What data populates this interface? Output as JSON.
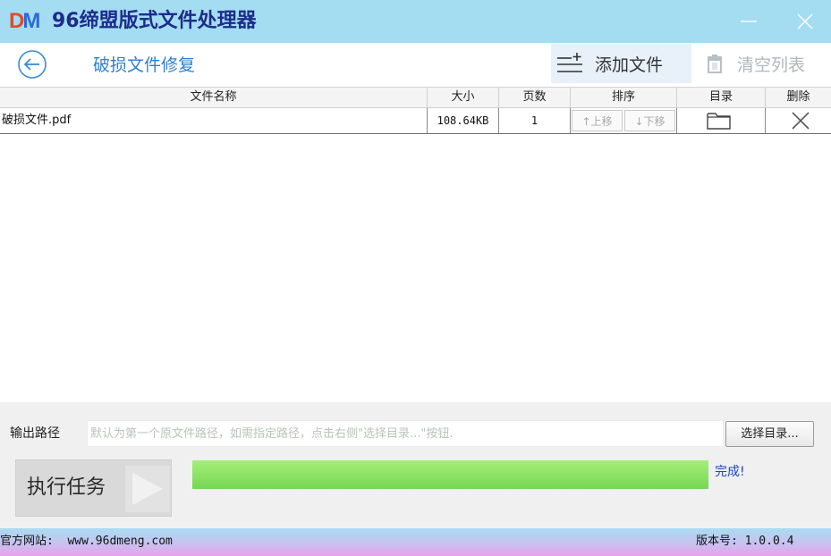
{
  "window": {
    "logo_d": "D",
    "logo_m": "M",
    "title": "96缔盟版式文件处理器"
  },
  "toolbar": {
    "page_title": "破损文件修复",
    "add_file_label": "添加文件",
    "clear_list_label": "清空列表"
  },
  "table": {
    "columns": [
      "文件名称",
      "大小",
      "页数",
      "排序",
      "目录",
      "删除"
    ],
    "rows": [
      {
        "name": "破损文件.pdf",
        "size": "108.64KB",
        "pages": "1",
        "move_up": "↑上移",
        "move_down": "↓下移"
      }
    ]
  },
  "output": {
    "label": "输出路径",
    "placeholder": "默认为第一个原文件路径，如需指定路径，点击右侧\"选择目录...\"按钮.",
    "choose_label": "选择目录..."
  },
  "task": {
    "execute_label": "执行任务",
    "progress": 1.0,
    "status_text": "完成!"
  },
  "statusbar": {
    "website": "官方网站:  www.96dmeng.com",
    "version": "版本号: 1.0.0.4"
  },
  "colors": {
    "titlebar": "#a4dcf2",
    "accent_blue": "#2f7fcf",
    "progress_green": "#8ae266",
    "done_text": "#1c44c8"
  },
  "icons": [
    "minimize-icon",
    "close-icon",
    "back-arrow-icon",
    "add-list-icon",
    "trash-icon",
    "folder-icon",
    "delete-x-icon",
    "play-icon"
  ]
}
